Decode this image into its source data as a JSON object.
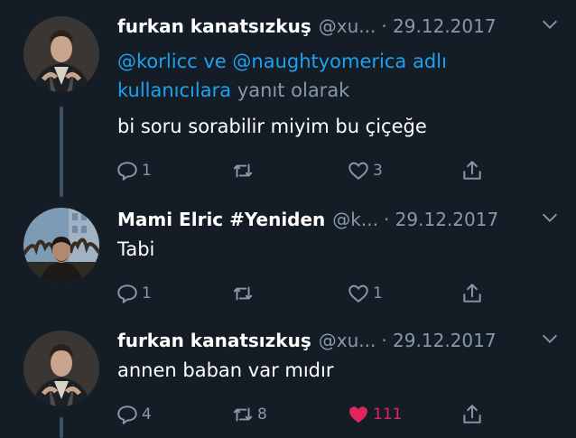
{
  "tweets": [
    {
      "name": "furkan kanatsızkuş",
      "handle": "@xu...",
      "date": "· 29.12.2017",
      "reply_to": {
        "mention1": "@korlicc",
        "joiner": "ve",
        "mention2": "@naughtyomerica adlı",
        "mention3": "kullanıcılara",
        "suffix": "yanıt olarak"
      },
      "text": "bi soru sorabilir miyim bu çiçeğe",
      "replies": "1",
      "retweets": "",
      "likes": "3"
    },
    {
      "name": "Mami Elric #Yeniden",
      "handle": "@k...",
      "date": "· 29.12.2017",
      "text": "Tabi",
      "replies": "1",
      "retweets": "",
      "likes": "1"
    },
    {
      "name": "furkan kanatsızkuş",
      "handle": "@xu...",
      "date": "· 29.12.2017",
      "text": "annen baban var mıdır",
      "replies": "4",
      "retweets": "8",
      "likes": "111"
    }
  ],
  "colors": {
    "background": "#141d26",
    "link": "#1da1f2",
    "muted": "#8899a6",
    "like": "#e0245e"
  },
  "icons": [
    "reply-icon",
    "retweet-icon",
    "like-icon",
    "share-icon",
    "chevron-down-icon"
  ]
}
